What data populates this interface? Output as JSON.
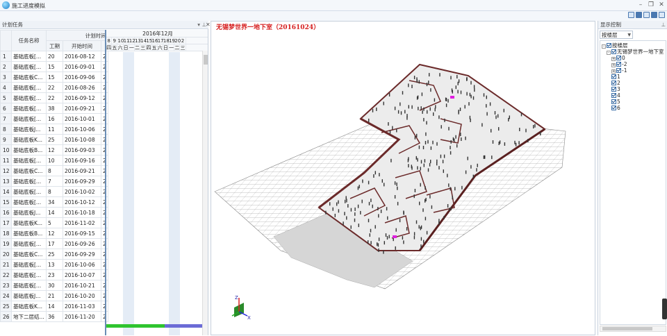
{
  "app": {
    "title": "施工进度模拟",
    "icon": "app-globe-icon"
  },
  "left_panel": {
    "title": "计划任务"
  },
  "table": {
    "col_name": "任务名称",
    "col_plan": "计划时间",
    "col_duration": "工期",
    "col_start": "开始时间",
    "rows": [
      {
        "n": "1",
        "name": "基础底板[...",
        "dur": "20",
        "start": "2016-08-12",
        "end": "2"
      },
      {
        "n": "2",
        "name": "基础底板[...",
        "dur": "15",
        "start": "2016-09-01",
        "end": "2"
      },
      {
        "n": "3",
        "name": "基础底板C...",
        "dur": "15",
        "start": "2016-09-06",
        "end": "2"
      },
      {
        "n": "4",
        "name": "基础底板[...",
        "dur": "22",
        "start": "2016-08-26",
        "end": "2"
      },
      {
        "n": "5",
        "name": "基础底板[...",
        "dur": "22",
        "start": "2016-09-12",
        "end": "2"
      },
      {
        "n": "6",
        "name": "基础底板[...",
        "dur": "38",
        "start": "2016-09-21",
        "end": "2"
      },
      {
        "n": "7",
        "name": "基础底板[...",
        "dur": "16",
        "start": "2016-10-01",
        "end": "2"
      },
      {
        "n": "8",
        "name": "基础底板J...",
        "dur": "11",
        "start": "2016-10-06",
        "end": "2"
      },
      {
        "n": "9",
        "name": "基础底板K...",
        "dur": "25",
        "start": "2016-10-08",
        "end": "2"
      },
      {
        "n": "10",
        "name": "基础底板B...",
        "dur": "12",
        "start": "2016-09-03",
        "end": "2"
      },
      {
        "n": "11",
        "name": "基础底板[...",
        "dur": "10",
        "start": "2016-09-16",
        "end": "2"
      },
      {
        "n": "12",
        "name": "基础底板C...",
        "dur": "8",
        "start": "2016-09-21",
        "end": "2"
      },
      {
        "n": "13",
        "name": "基础底板[...",
        "dur": "7",
        "start": "2016-09-29",
        "end": "2"
      },
      {
        "n": "14",
        "name": "基础底板[...",
        "dur": "8",
        "start": "2016-10-02",
        "end": "2"
      },
      {
        "n": "15",
        "name": "基础底板[...",
        "dur": "34",
        "start": "2016-10-12",
        "end": "2"
      },
      {
        "n": "16",
        "name": "基础底板J...",
        "dur": "14",
        "start": "2016-10-18",
        "end": "2"
      },
      {
        "n": "17",
        "name": "基础底板K...",
        "dur": "5",
        "start": "2016-11-02",
        "end": "2"
      },
      {
        "n": "18",
        "name": "基础底板B...",
        "dur": "12",
        "start": "2016-09-15",
        "end": "2"
      },
      {
        "n": "19",
        "name": "基础底板[...",
        "dur": "17",
        "start": "2016-09-26",
        "end": "2"
      },
      {
        "n": "20",
        "name": "基础底板C...",
        "dur": "25",
        "start": "2016-09-29",
        "end": "2"
      },
      {
        "n": "21",
        "name": "基础底板[...",
        "dur": "13",
        "start": "2016-10-06",
        "end": "2"
      },
      {
        "n": "22",
        "name": "基础底板[...",
        "dur": "23",
        "start": "2016-10-07",
        "end": "2"
      },
      {
        "n": "23",
        "name": "基础底板[...",
        "dur": "30",
        "start": "2016-10-21",
        "end": "2"
      },
      {
        "n": "24",
        "name": "基础底板J...",
        "dur": "21",
        "start": "2016-10-20",
        "end": "2"
      },
      {
        "n": "25",
        "name": "基础底板K...",
        "dur": "14",
        "start": "2016-11-03",
        "end": "2"
      },
      {
        "n": "26",
        "name": "地下二层结...",
        "dur": "36",
        "start": "2016-11-20",
        "end": "2"
      }
    ]
  },
  "gantt": {
    "month": "2016年12月",
    "days": [
      "8",
      "9",
      "10",
      "11",
      "12",
      "13",
      "14",
      "15",
      "16",
      "17",
      "18",
      "19",
      "20",
      "2"
    ],
    "weekdays": [
      "四",
      "五",
      "六",
      "日",
      "一",
      "二",
      "三",
      "四",
      "五",
      "六",
      "日",
      "一",
      "二",
      "三"
    ],
    "bar_colors": [
      "#2fc42f",
      "#6b6bd6"
    ]
  },
  "viewport": {
    "title": "无锡梦世界一地下室（20161024）",
    "axis_labels": {
      "z": "Z",
      "x": "X"
    }
  },
  "right_panel": {
    "title": "显示控制",
    "layer_select": "按楼层",
    "tree": [
      {
        "label": "按楼层",
        "depth": 0,
        "expand": "-"
      },
      {
        "label": "无锡梦世界一地下室",
        "depth": 1,
        "expand": "-"
      },
      {
        "label": "0",
        "depth": 2,
        "expand": "+"
      },
      {
        "label": "-2",
        "depth": 2,
        "expand": "+"
      },
      {
        "label": "-1",
        "depth": 2,
        "expand": "+"
      },
      {
        "label": "1",
        "depth": 2,
        "expand": ""
      },
      {
        "label": "2",
        "depth": 2,
        "expand": ""
      },
      {
        "label": "3",
        "depth": 2,
        "expand": ""
      },
      {
        "label": "4",
        "depth": 2,
        "expand": ""
      },
      {
        "label": "5",
        "depth": 2,
        "expand": ""
      },
      {
        "label": "6",
        "depth": 2,
        "expand": ""
      }
    ]
  },
  "colors": {
    "wall": "#6b2a2a",
    "slab": "#d9d9d9",
    "grid": "#9a9a9a",
    "accent": "#d62020"
  }
}
